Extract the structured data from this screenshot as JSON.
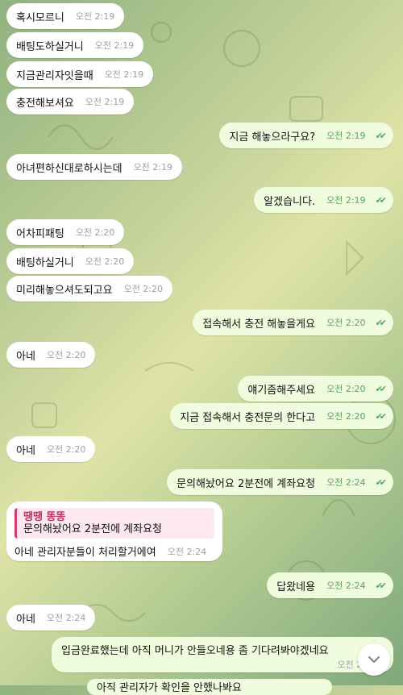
{
  "messages": [
    {
      "id": "m1",
      "text": "혹시모르니",
      "time": "오전 2:19",
      "dir": "in"
    },
    {
      "id": "m2",
      "text": "배팅도하실거니",
      "time": "오전 2:19",
      "dir": "in"
    },
    {
      "id": "m3",
      "text": "지금관리자잇을때",
      "time": "오전 2:19",
      "dir": "in"
    },
    {
      "id": "m4",
      "text": "충전해보셔요",
      "time": "오전 2:19",
      "dir": "in"
    },
    {
      "id": "m5",
      "text": "지금 해놓으라구요?",
      "time": "오전 2:19",
      "dir": "out"
    },
    {
      "id": "m6",
      "text": "아녀편하신대로하시는데",
      "time": "오전 2:19",
      "dir": "in"
    },
    {
      "id": "m7",
      "text": "알겠습니다.",
      "time": "오전 2:19",
      "dir": "out"
    },
    {
      "id": "m8",
      "text": "어차피패팅",
      "time": "오전 2:20",
      "dir": "in"
    },
    {
      "id": "m9",
      "text": "배팅하실거니",
      "time": "오전 2:20",
      "dir": "in"
    },
    {
      "id": "m10",
      "text": "미리해놓으셔도되고요",
      "time": "오전 2:20",
      "dir": "in"
    },
    {
      "id": "m11",
      "text": "접속해서 충전 해놓을게요",
      "time": "오전 2:20",
      "dir": "out"
    },
    {
      "id": "m12",
      "text": "아네",
      "time": "오전 2:20",
      "dir": "in"
    },
    {
      "id": "m13",
      "text": "얘기좀해주세요",
      "time": "오전 2:20",
      "dir": "out"
    },
    {
      "id": "m14",
      "text": "지금 접속해서 충전문의 한다고",
      "time": "오전 2:20",
      "dir": "out"
    },
    {
      "id": "m15",
      "text": "아네",
      "time": "오전 2:20",
      "dir": "in"
    },
    {
      "id": "m16",
      "text": "문의해놨어요 2분전에 계좌요청",
      "time": "오전 2:24",
      "dir": "out"
    },
    {
      "id": "m18",
      "text": "답왔네용",
      "time": "오전 2:24",
      "dir": "out"
    },
    {
      "id": "m19",
      "text": "아네",
      "time": "오전 2:24",
      "dir": "in"
    }
  ],
  "reply": {
    "quote_author": "땡땡 똥똥",
    "quote_text": "문의해놨어요 2분전에 계좌요청",
    "text": "아네 관리자분들이 처리할거에여",
    "time": "오전 2:24"
  },
  "long_message": {
    "text": "입금완료했는데 아직 머니가 안들오네용 좀 기다려봐야겠네요",
    "time": "오전 2:2"
  },
  "cut_message": {
    "text": "아직 관리자가 확인을 안했나봐요"
  },
  "scroll_button": {
    "icon": "chevron-down-icon"
  }
}
